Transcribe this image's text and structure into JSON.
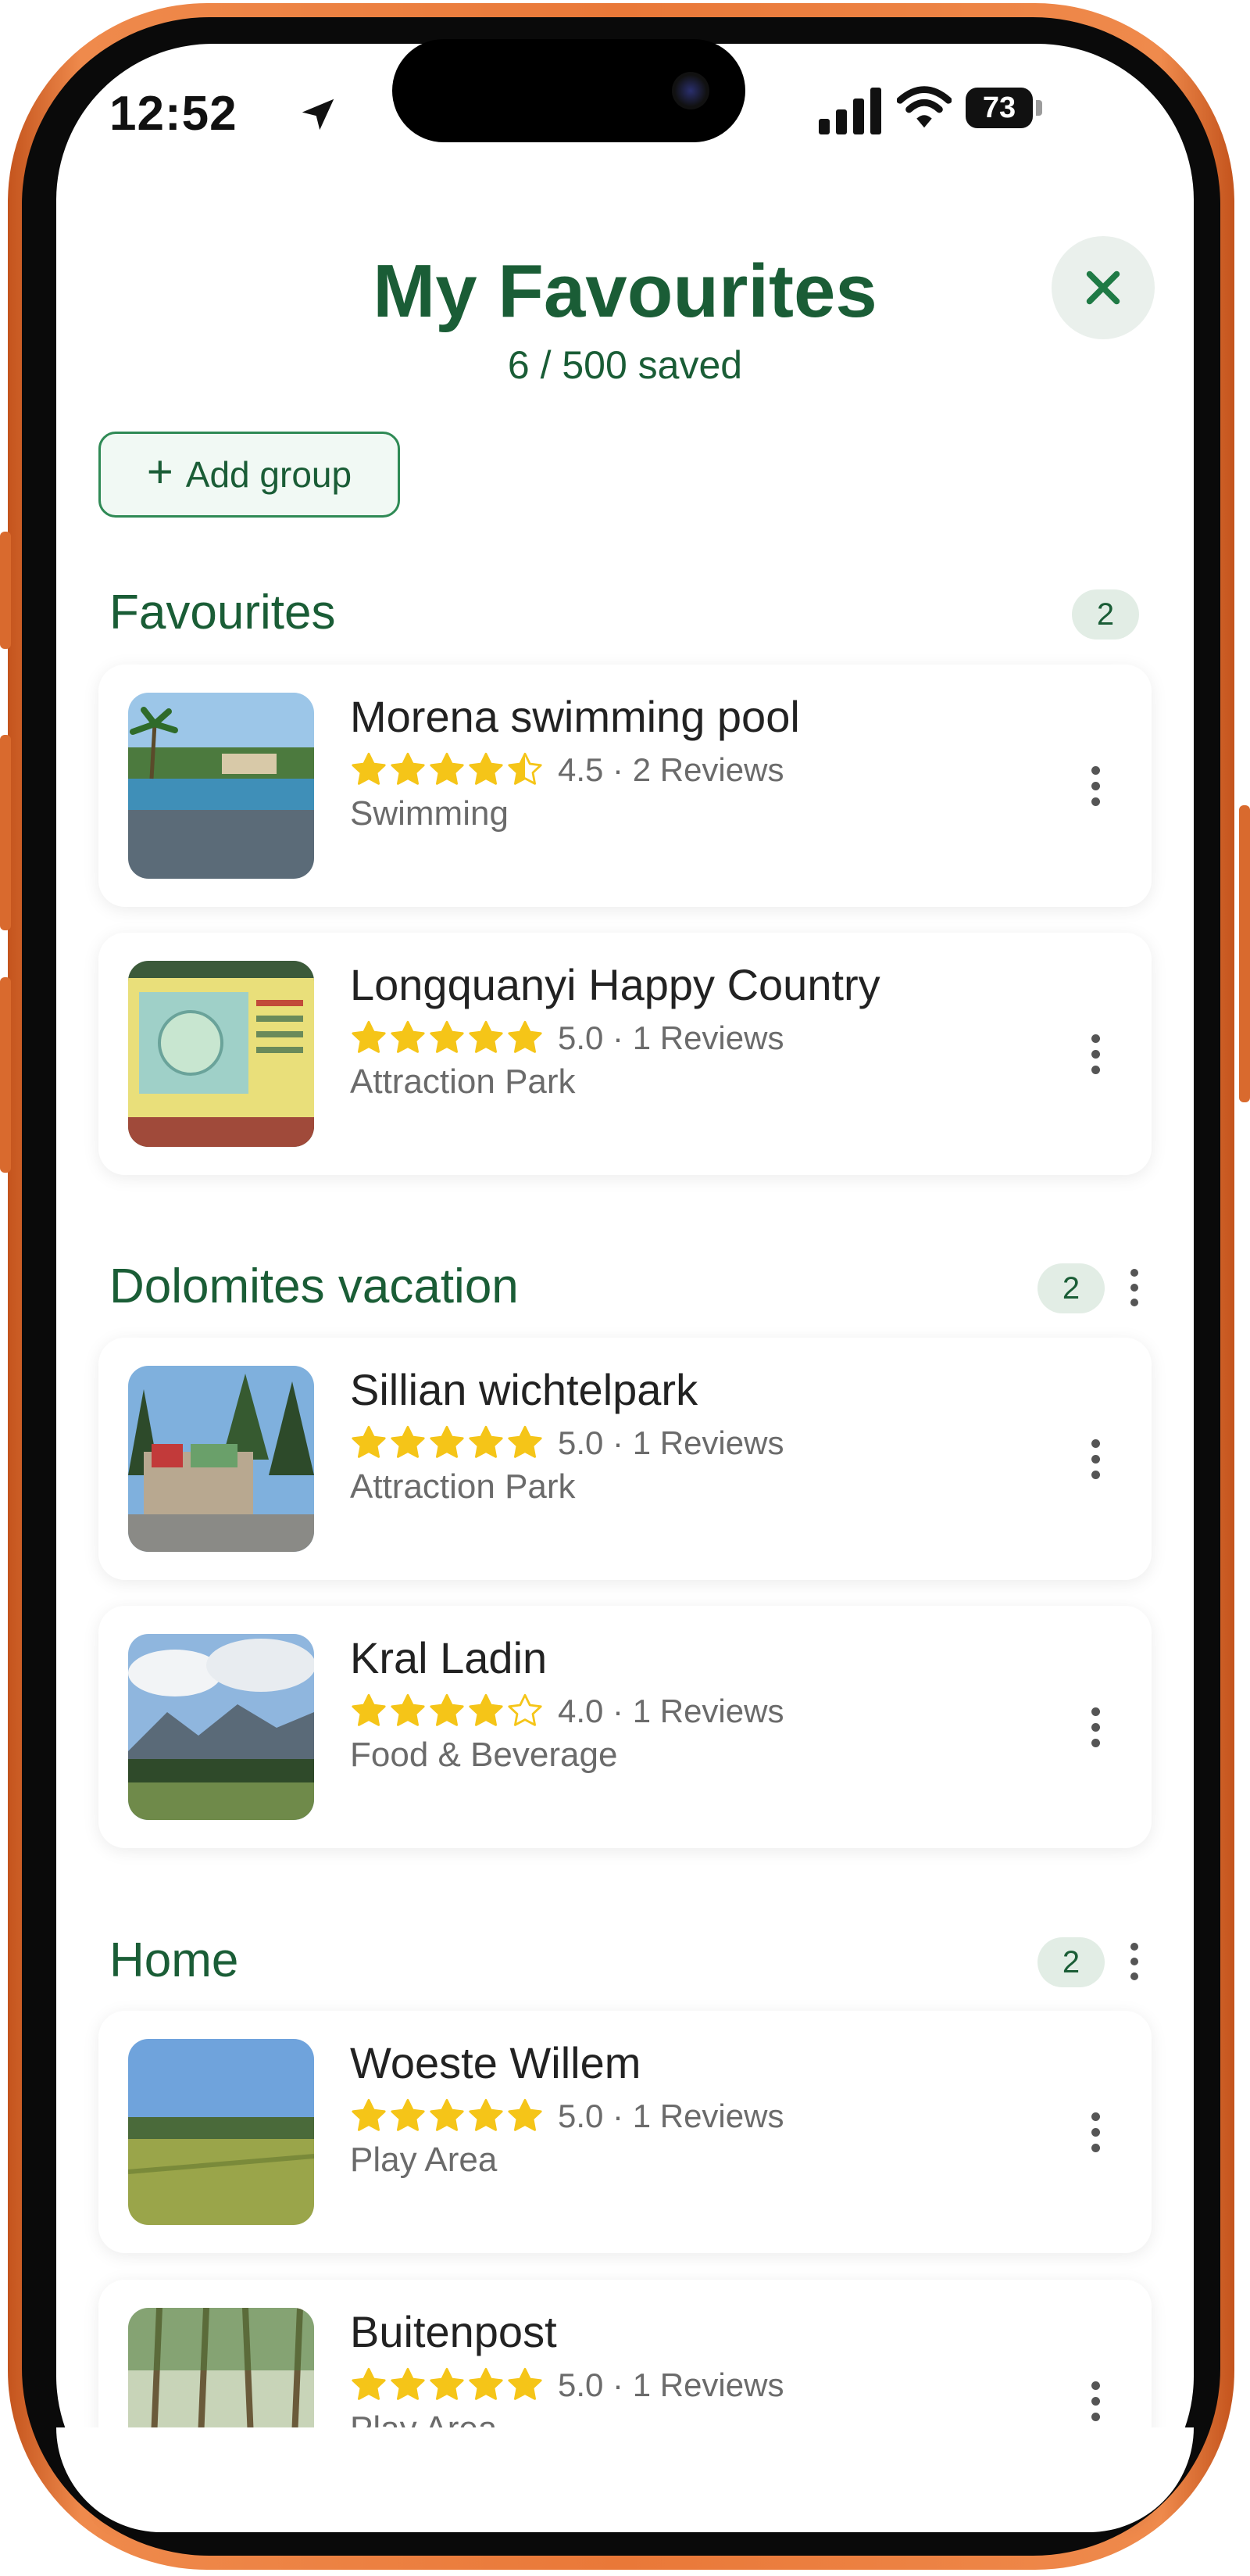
{
  "status_bar": {
    "time": "12:52",
    "battery": "73"
  },
  "header": {
    "title": "My Favourites",
    "subtitle": "6 / 500 saved"
  },
  "add_group": {
    "label": "Add group"
  },
  "colors": {
    "brand_green": "#1a5d36",
    "star_yellow": "#f5c518",
    "badge_bg": "#e2ede5"
  },
  "groups": [
    {
      "title": "Favourites",
      "count": "2",
      "items": [
        {
          "name": "Morena swimming pool",
          "rating": 4.5,
          "rating_text": "4.5 · 2 Reviews",
          "category": "Swimming"
        },
        {
          "name": "Longquanyi Happy Country",
          "rating": 5.0,
          "rating_text": "5.0 · 1 Reviews",
          "category": "Attraction Park"
        }
      ]
    },
    {
      "title": "Dolomites vacation",
      "count": "2",
      "items": [
        {
          "name": "Sillian wichtelpark",
          "rating": 5.0,
          "rating_text": "5.0 · 1 Reviews",
          "category": "Attraction Park"
        },
        {
          "name": "Kral Ladin",
          "rating": 4.0,
          "rating_text": "4.0 · 1 Reviews",
          "category": "Food & Beverage"
        }
      ]
    },
    {
      "title": "Home",
      "count": "2",
      "items": [
        {
          "name": "Woeste Willem",
          "rating": 5.0,
          "rating_text": "5.0 · 1 Reviews",
          "category": "Play Area"
        },
        {
          "name": "Buitenpost",
          "rating": 5.0,
          "rating_text": "5.0 · 1 Reviews",
          "category": "Play Area"
        }
      ]
    }
  ]
}
